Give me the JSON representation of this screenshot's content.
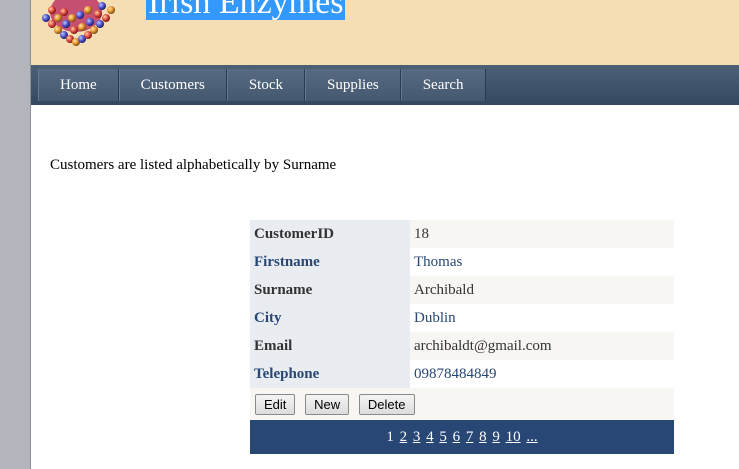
{
  "header": {
    "title": "Irish Enzymes"
  },
  "nav": {
    "items": [
      "Home",
      "Customers",
      "Stock",
      "Supplies",
      "Search"
    ]
  },
  "intro": "Customers are listed alphabetically by Surname",
  "record": {
    "fields": [
      {
        "label": "CustomerID",
        "value": "18"
      },
      {
        "label": "Firstname",
        "value": "Thomas"
      },
      {
        "label": "Surname",
        "value": "Archibald"
      },
      {
        "label": "City",
        "value": "Dublin"
      },
      {
        "label": "Email",
        "value": "archibaldt@gmail.com"
      },
      {
        "label": "Telephone",
        "value": "09878484849"
      }
    ],
    "buttons": {
      "edit": "Edit",
      "new": "New",
      "delete": "Delete"
    }
  },
  "pager": {
    "current": "1",
    "pages": [
      "2",
      "3",
      "4",
      "5",
      "6",
      "7",
      "8",
      "9",
      "10"
    ],
    "more": "..."
  },
  "colors": {
    "header_bg": "#f5deb3",
    "title_highlight": "#3399ff",
    "nav_bg": "#3d5168",
    "pager_bg": "#284775",
    "label_bg": "#e9ecf1",
    "link_blue": "#284775"
  }
}
